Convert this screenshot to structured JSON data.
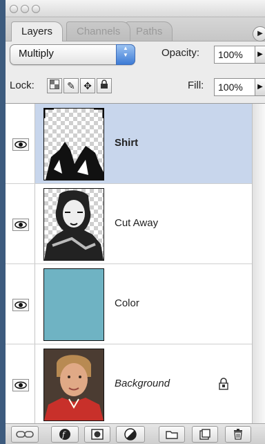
{
  "tabs": [
    {
      "label": "Layers",
      "active": true
    },
    {
      "label": "Channels",
      "active": false
    },
    {
      "label": "Paths",
      "active": false
    }
  ],
  "blend_mode": "Multiply",
  "opacity": {
    "label": "Opacity:",
    "value": "100%"
  },
  "lock": {
    "label": "Lock:"
  },
  "fill": {
    "label": "Fill:",
    "value": "100%"
  },
  "layers": [
    {
      "name": "Shirt",
      "selected": true,
      "visible": true
    },
    {
      "name": "Cut Away",
      "selected": false,
      "visible": true
    },
    {
      "name": "Color",
      "selected": false,
      "visible": true,
      "swatch": "#6fb3c3"
    },
    {
      "name": "Background",
      "selected": false,
      "visible": true,
      "locked": true
    }
  ],
  "colors": {
    "selection": "#c8d6ec",
    "accent": "#3d7bd6",
    "desktop": "#3d5b7e"
  },
  "icons": [
    "link-icon",
    "layer-style-icon",
    "layer-mask-icon",
    "adjustment-layer-icon",
    "new-group-icon",
    "new-layer-icon",
    "trash-icon"
  ]
}
